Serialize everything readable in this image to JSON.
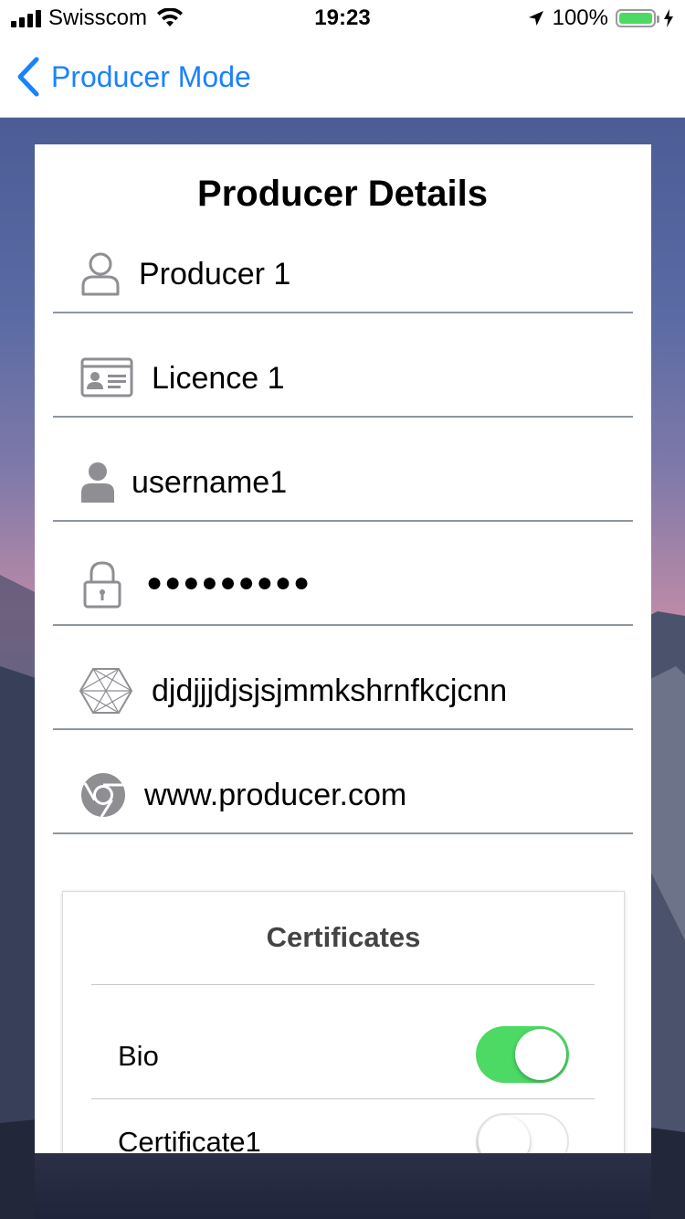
{
  "status_bar": {
    "carrier": "Swisscom",
    "time": "19:23",
    "battery_percent": "100%",
    "signal_bars": 4,
    "battery_level": 1.0
  },
  "nav": {
    "back_label": "Producer Mode",
    "back_icon": "chevron-left-icon",
    "accent_color": "#1a82ff"
  },
  "form": {
    "title": "Producer Details",
    "fields": [
      {
        "icon": "user-outline-icon",
        "value": "Producer 1"
      },
      {
        "icon": "id-card-icon",
        "value": "Licence 1"
      },
      {
        "icon": "user-filled-icon",
        "value": "username1"
      },
      {
        "icon": "lock-icon",
        "value": "●●●●●●●●●"
      },
      {
        "icon": "hexagon-key-icon",
        "value": "djdjjjdjsjsjmmkshrnfkcjcnn"
      },
      {
        "icon": "browser-icon",
        "value": "www.producer.com"
      }
    ]
  },
  "certificates": {
    "title": "Certificates",
    "items": [
      {
        "label": "Bio",
        "enabled": true
      },
      {
        "label": "Certificate1",
        "enabled": false
      }
    ],
    "toggle_on_color": "#4cd964"
  }
}
